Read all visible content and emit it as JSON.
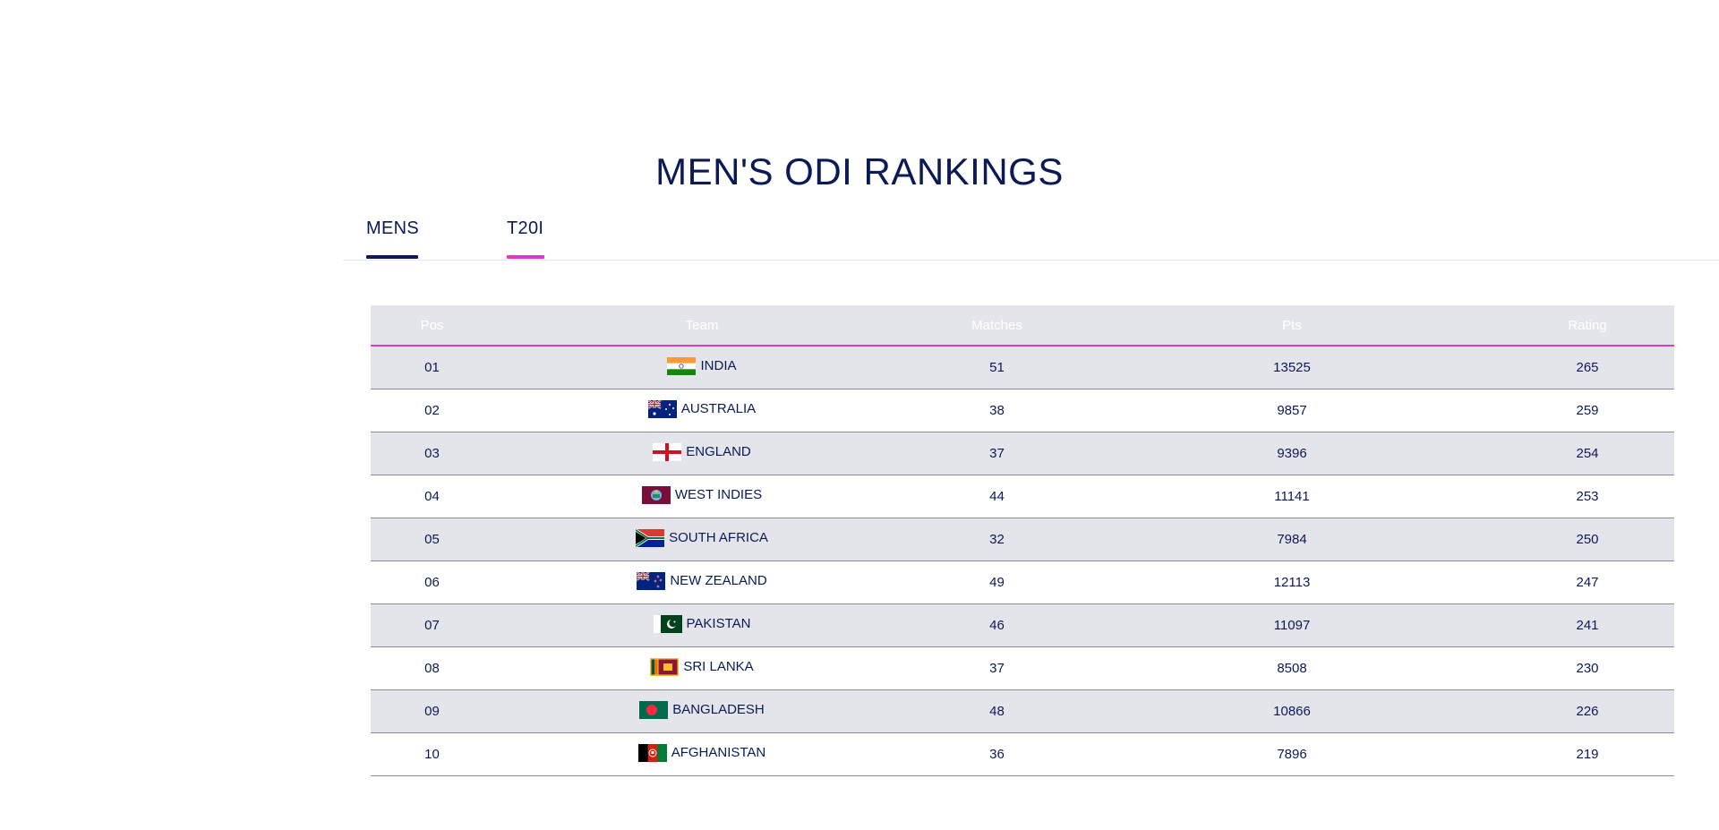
{
  "page": {
    "title": "MEN'S ODI RANKINGS"
  },
  "tabs": [
    {
      "label": "MENS",
      "underline_color": "#0b1a57",
      "active": true
    },
    {
      "label": "T20I",
      "underline_color": "#e535c6",
      "active": true
    }
  ],
  "table": {
    "headers": [
      "Pos",
      "Team",
      "Matches",
      "Pts",
      "Rating"
    ],
    "rows": [
      {
        "pos": "01",
        "team": "INDIA",
        "flag_icon": "india-flag-icon",
        "matches": "51",
        "pts": "13525",
        "rating": "265"
      },
      {
        "pos": "02",
        "team": "AUSTRALIA",
        "flag_icon": "australia-flag-icon",
        "matches": "38",
        "pts": "9857",
        "rating": "259"
      },
      {
        "pos": "03",
        "team": "ENGLAND",
        "flag_icon": "england-flag-icon",
        "matches": "37",
        "pts": "9396",
        "rating": "254"
      },
      {
        "pos": "04",
        "team": "WEST INDIES",
        "flag_icon": "west-indies-flag-icon",
        "matches": "44",
        "pts": "11141",
        "rating": "253"
      },
      {
        "pos": "05",
        "team": "SOUTH AFRICA",
        "flag_icon": "south-africa-flag-icon",
        "matches": "32",
        "pts": "7984",
        "rating": "250"
      },
      {
        "pos": "06",
        "team": "NEW ZEALAND",
        "flag_icon": "new-zealand-flag-icon",
        "matches": "49",
        "pts": "12113",
        "rating": "247"
      },
      {
        "pos": "07",
        "team": "PAKISTAN",
        "flag_icon": "pakistan-flag-icon",
        "matches": "46",
        "pts": "11097",
        "rating": "241"
      },
      {
        "pos": "08",
        "team": "SRI LANKA",
        "flag_icon": "sri-lanka-flag-icon",
        "matches": "37",
        "pts": "8508",
        "rating": "230"
      },
      {
        "pos": "09",
        "team": "BANGLADESH",
        "flag_icon": "bangladesh-flag-icon",
        "matches": "48",
        "pts": "10866",
        "rating": "226"
      },
      {
        "pos": "10",
        "team": "AFGHANISTAN",
        "flag_icon": "afghanistan-flag-icon",
        "matches": "36",
        "pts": "7896",
        "rating": "219"
      }
    ]
  },
  "colors": {
    "text_navy": "#0b1a57",
    "accent_magenta": "#e535c6",
    "row_alt_bg": "#e4e5ea"
  }
}
